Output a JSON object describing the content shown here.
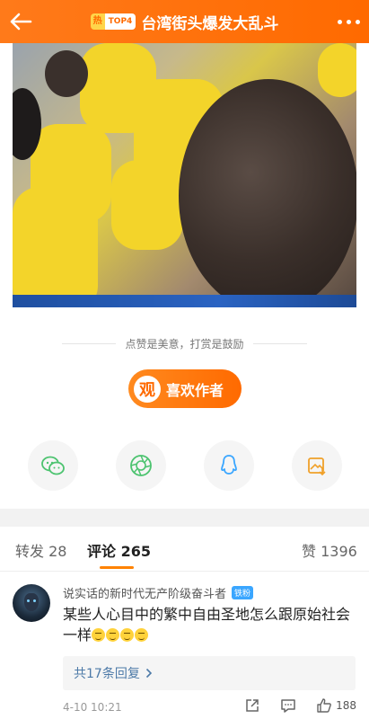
{
  "header": {
    "hot_label": "热",
    "top_label": "TOP4",
    "title": "台湾街头爆发大乱斗"
  },
  "video": {
    "alt": ""
  },
  "encourage": {
    "text": "点赞是美意，打赏是鼓励",
    "like_author_icon": "观",
    "like_author_label": "喜欢作者"
  },
  "share": [
    {
      "icon": "wechat-icon"
    },
    {
      "icon": "moments-icon"
    },
    {
      "icon": "qq-icon"
    },
    {
      "icon": "save-image-icon"
    }
  ],
  "tabs": {
    "repost": "转发 28",
    "comments": "评论 265",
    "likes": "赞 1396"
  },
  "comment": {
    "username": "说实话的新时代无产阶级奋斗者",
    "badge": "铁粉",
    "text": "某些人心目中的繁中自由圣地怎么跟原始社会一样",
    "replies": "共17条回复",
    "time": "4-10 10:21",
    "like_count": "188"
  },
  "colors": {
    "accent": "#ff6a00",
    "link": "#4d7aa8"
  }
}
